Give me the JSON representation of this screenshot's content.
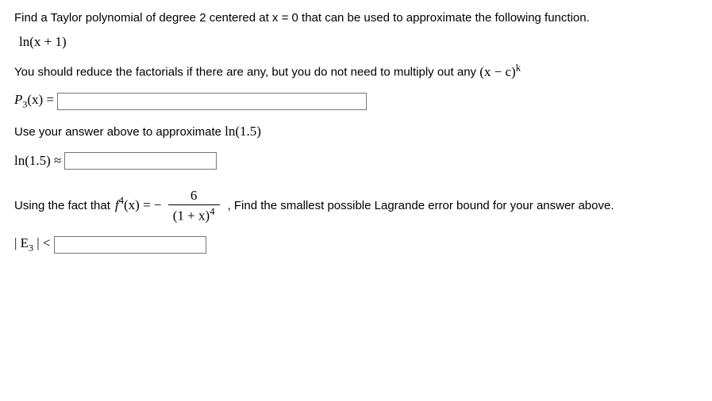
{
  "problem": {
    "intro": "Find a Taylor polynomial of degree 2 centered at x = 0   that can be used to approximate the following function.",
    "function": "ln(x + 1)",
    "reduce_note_prefix": "You should reduce the factorials if there are any, but you do not need to multiply out any ",
    "power_expr_base": "(x − c)",
    "power_expr_exp": "k"
  },
  "q1": {
    "label": "P",
    "label_sub": "3",
    "label_arg": "(x) =",
    "value": ""
  },
  "q2": {
    "prompt_prefix": "Use your answer above to approximate ",
    "prompt_expr": "ln(1.5)",
    "label": "ln(1.5) ≈",
    "value": ""
  },
  "q3": {
    "prefix": "Using the fact that ",
    "expr_left": "f",
    "expr_exp": "4",
    "expr_arg": "(x) = −",
    "frac_num": "6",
    "frac_den_base": "(1 + x)",
    "frac_den_exp": "4",
    "suffix": ", Find the smallest possible Lagrande error bound for your answer above."
  },
  "q4": {
    "label": "| E",
    "label_sub": "3",
    "label_tail": " | <",
    "value": ""
  }
}
